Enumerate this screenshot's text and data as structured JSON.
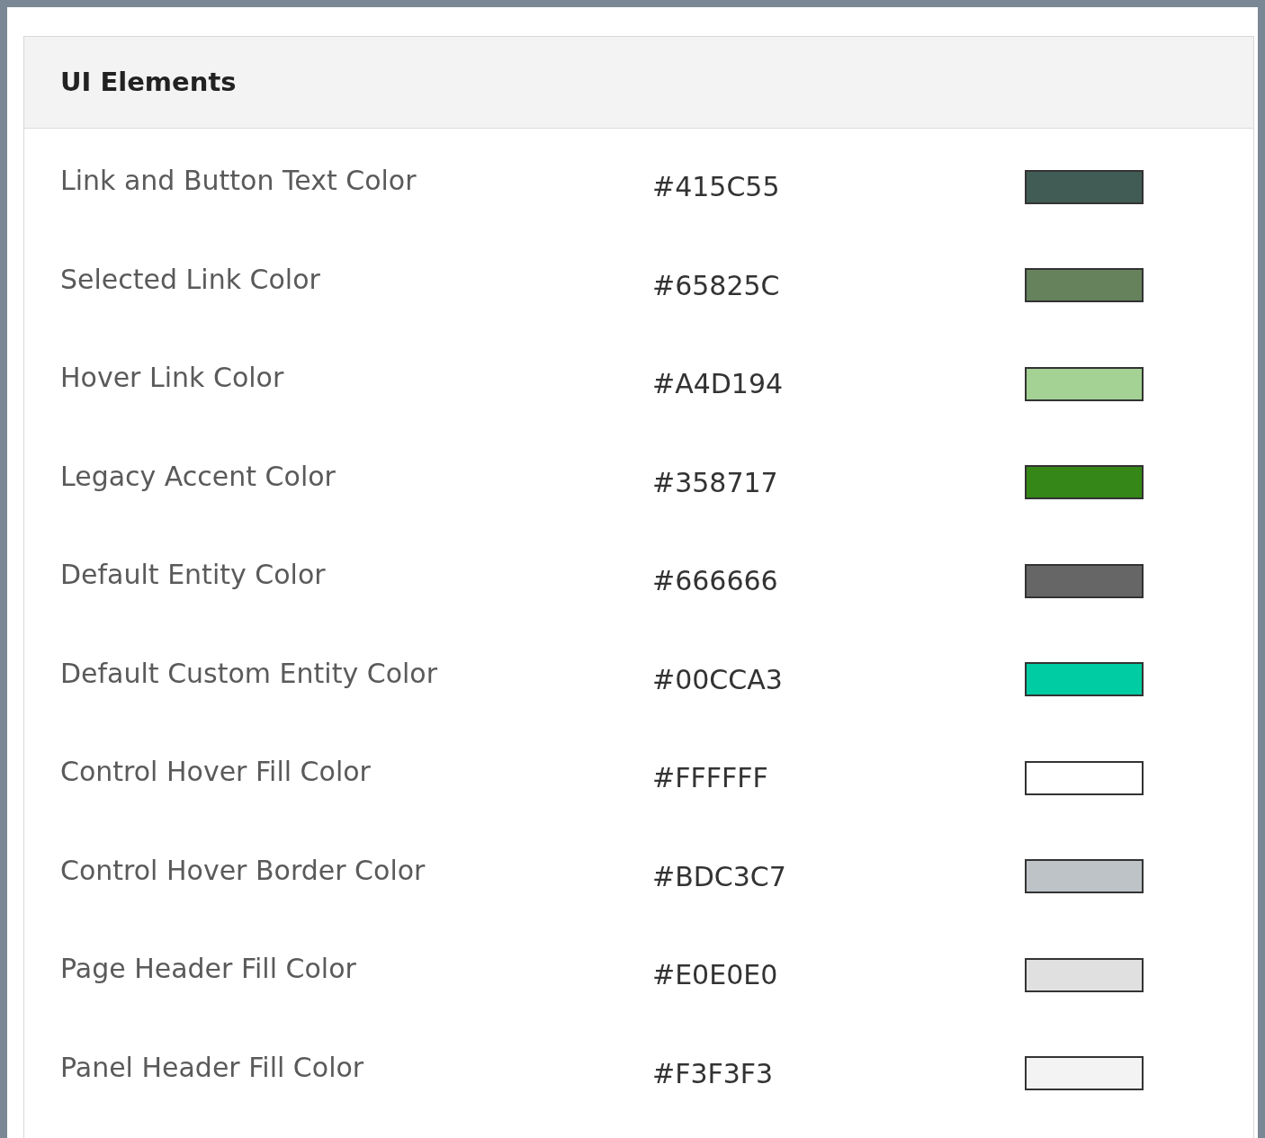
{
  "panel": {
    "title": "UI Elements"
  },
  "rows": [
    {
      "label": "Link and Button Text Color",
      "value": "#415C55",
      "color": "#415c55"
    },
    {
      "label": "Selected Link Color",
      "value": "#65825C",
      "color": "#65825c"
    },
    {
      "label": "Hover Link Color",
      "value": "#A4D194",
      "color": "#a4d194"
    },
    {
      "label": "Legacy Accent Color",
      "value": "#358717",
      "color": "#358717"
    },
    {
      "label": "Default Entity Color",
      "value": "#666666",
      "color": "#666666"
    },
    {
      "label": "Default Custom Entity Color",
      "value": "#00CCA3",
      "color": "#00cca3"
    },
    {
      "label": "Control Hover Fill Color",
      "value": "#FFFFFF",
      "color": "#ffffff"
    },
    {
      "label": "Control Hover Border Color",
      "value": "#BDC3C7",
      "color": "#bdc3c7"
    },
    {
      "label": "Page Header Fill Color",
      "value": "#E0E0E0",
      "color": "#e0e0e0"
    },
    {
      "label": "Panel Header Fill Color",
      "value": "#F3F3F3",
      "color": "#f3f3f3"
    }
  ]
}
